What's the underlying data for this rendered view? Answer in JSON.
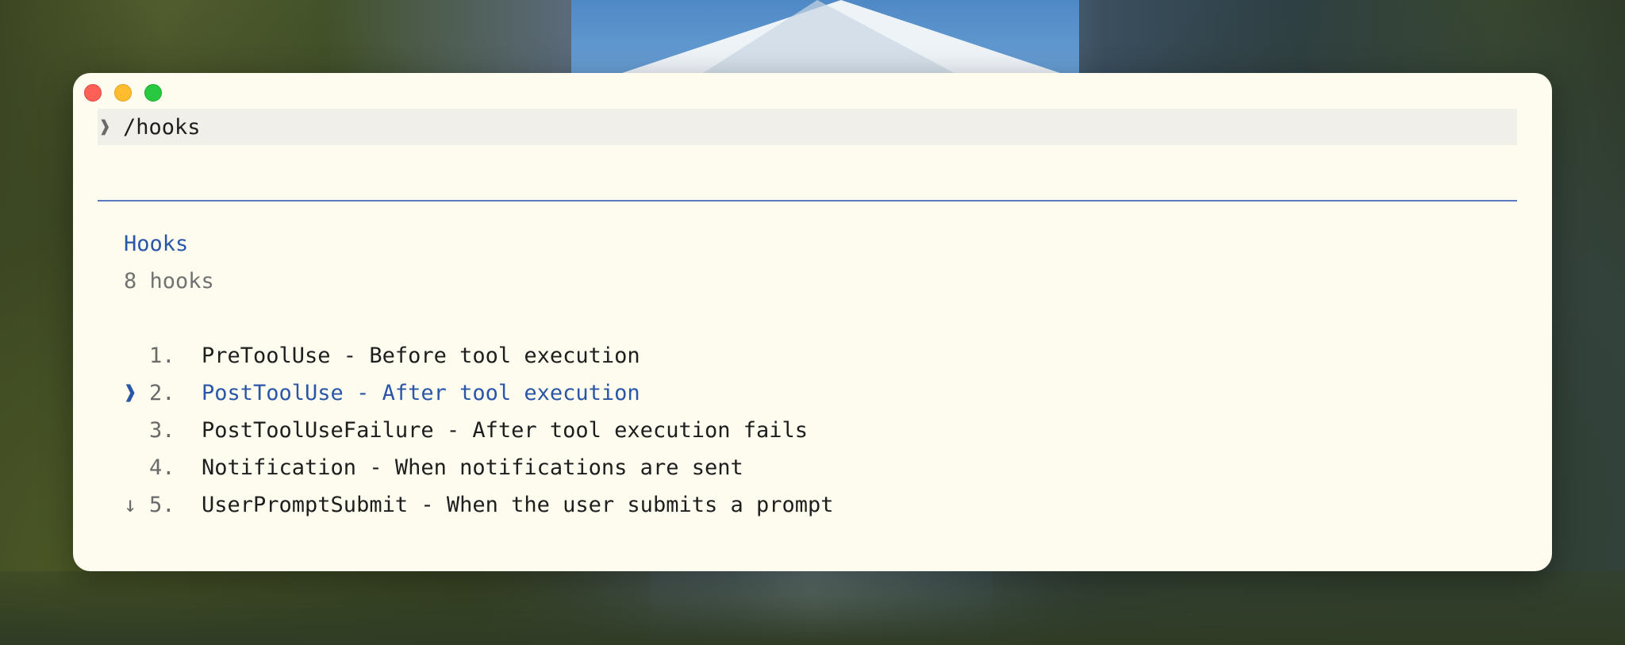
{
  "prompt": {
    "caret": "❱",
    "command": "/hooks"
  },
  "panel": {
    "title": "Hooks",
    "count": "8 hooks"
  },
  "hooks": [
    {
      "marker": "",
      "number": "1.",
      "label": "PreToolUse - Before tool execution"
    },
    {
      "marker": "❱",
      "number": "2.",
      "label": "PostToolUse - After tool execution"
    },
    {
      "marker": "",
      "number": "3.",
      "label": "PostToolUseFailure - After tool execution fails"
    },
    {
      "marker": "",
      "number": "4.",
      "label": "Notification - When notifications are sent"
    },
    {
      "marker": "↓",
      "number": "5.",
      "label": "UserPromptSubmit - When the user submits a prompt"
    }
  ],
  "colors": {
    "window_bg": "#fdfcef",
    "accent": "#2a56a8",
    "muted": "#727272",
    "prompt_bg": "#f0efea"
  }
}
